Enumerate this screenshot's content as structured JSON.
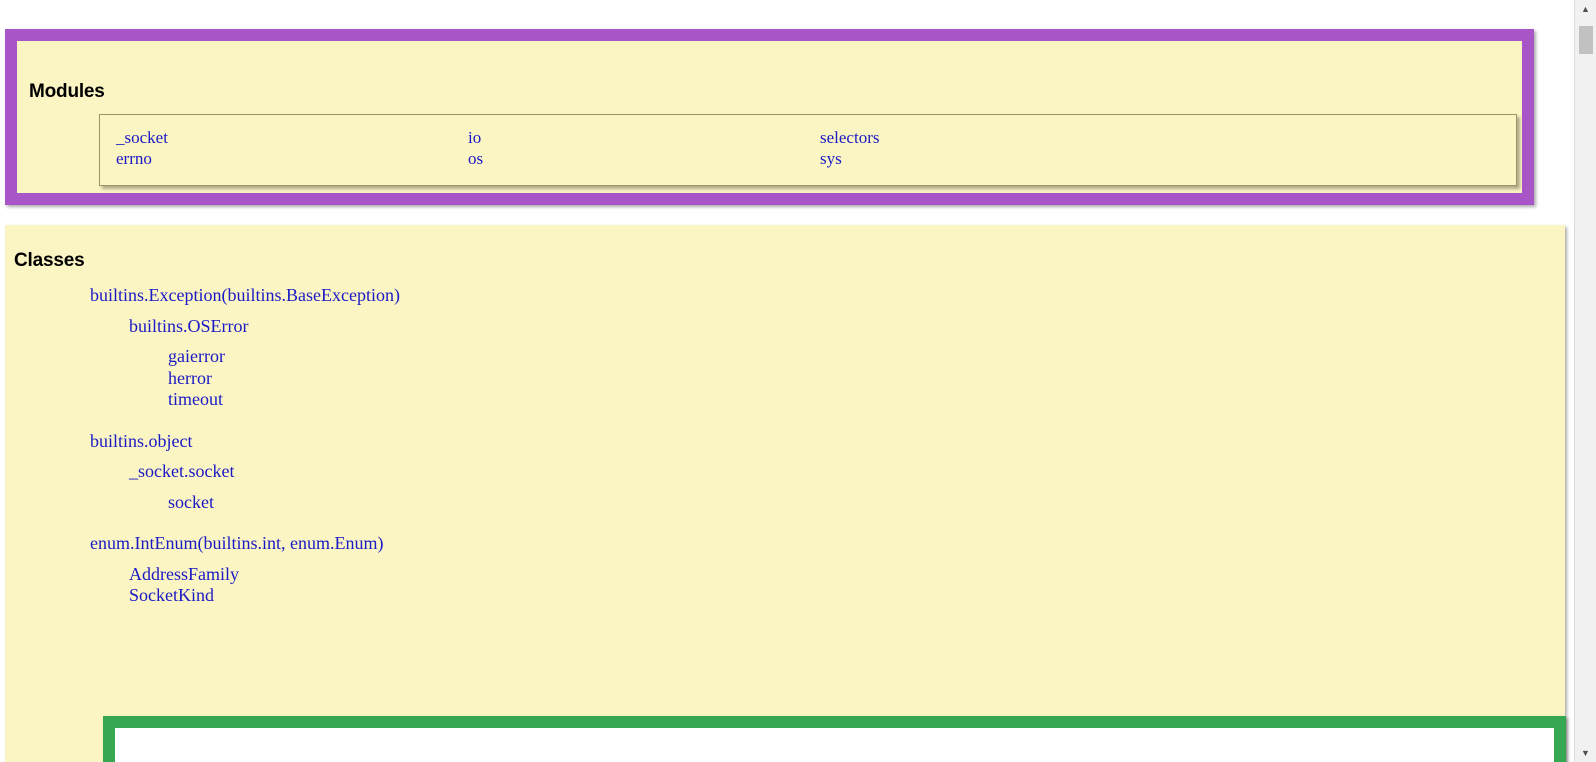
{
  "page": {
    "background": "#ffffff",
    "section_background": "#fbf5c4",
    "link_color": "#1a1ac4",
    "highlight_purple": "#a855c8",
    "highlight_green": "#36a852",
    "table_border_color": "#9c9468"
  },
  "modules": {
    "title": "Modules",
    "columns": [
      [
        "_socket",
        "errno"
      ],
      [
        "io",
        "os"
      ],
      [
        "selectors",
        "sys"
      ]
    ]
  },
  "classes": {
    "title": "Classes",
    "tree": [
      {
        "label": "builtins.Exception(builtins.BaseException)",
        "indent": 1
      },
      {
        "label": "builtins.OSError",
        "indent": 2
      },
      {
        "label": "gaierror",
        "indent": 3
      },
      {
        "label": "herror",
        "indent": 3
      },
      {
        "label": "timeout",
        "indent": 3
      },
      {
        "label": "builtins.object",
        "indent": 1
      },
      {
        "label": "_socket.socket",
        "indent": 2
      },
      {
        "label": "socket",
        "indent": 3
      },
      {
        "label": "enum.IntEnum(builtins.int, enum.Enum)",
        "indent": 1
      },
      {
        "label": "AddressFamily",
        "indent": 2
      },
      {
        "label": "SocketKind",
        "indent": 2
      }
    ]
  },
  "scrollbar": {
    "up_arrow": "▲",
    "down_arrow": "▼"
  }
}
